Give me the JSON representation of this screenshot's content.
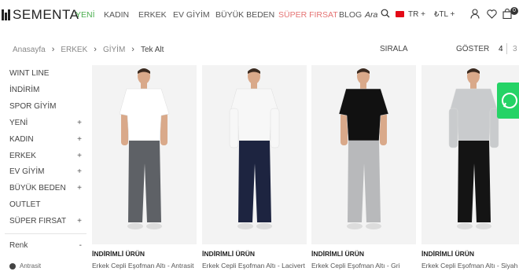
{
  "header": {
    "logo_text": "SEMENTA",
    "nav": [
      {
        "label": "YENİ",
        "style": "green"
      },
      {
        "label": "KADIN",
        "style": "normal"
      },
      {
        "label": "ERKEK",
        "style": "normal"
      },
      {
        "label": "EV GİYİM",
        "style": "normal"
      },
      {
        "label": "BÜYÜK BEDEN",
        "style": "normal"
      },
      {
        "label": "SÜPER FIRSAT",
        "style": "red"
      },
      {
        "label": "BLOG",
        "style": "normal"
      }
    ],
    "search_label": "Ara",
    "language": "TR +",
    "currency": "₺TL +",
    "cart_count": "0"
  },
  "breadcrumb": {
    "items": [
      "Anasayfa",
      "ERKEK",
      "GİYİM"
    ],
    "current": "Tek Alt"
  },
  "toolbar": {
    "sort_label": "SIRALA",
    "show_label": "GÖSTER",
    "page_active": "4",
    "page_other": "3"
  },
  "sidebar": {
    "items": [
      {
        "label": "WINT LINE",
        "plus": ""
      },
      {
        "label": "İNDİRİM",
        "plus": ""
      },
      {
        "label": "SPOR GİYİM",
        "plus": ""
      },
      {
        "label": "YENİ",
        "plus": "+"
      },
      {
        "label": "KADIN",
        "plus": "+"
      },
      {
        "label": "ERKEK",
        "plus": "+"
      },
      {
        "label": "EV GİYİM",
        "plus": "+"
      },
      {
        "label": "BÜYÜK BEDEN",
        "plus": "+"
      },
      {
        "label": "OUTLET",
        "plus": ""
      },
      {
        "label": "SÜPER FIRSAT",
        "plus": "+"
      }
    ],
    "filter_title": "Renk",
    "filter_toggle": "-",
    "filter_option": "Antrasit"
  },
  "products": [
    {
      "label": "İNDİRİMLİ ÜRÜN",
      "title": "Erkek Cepli Eşofman Altı - Antrasit",
      "shirt": "#ffffff",
      "pants": "#5e6166"
    },
    {
      "label": "İNDİRİMLİ ÜRÜN",
      "title": "Erkek Cepli Eşofman Altı - Lacivert",
      "shirt": "#f7f7f7",
      "pants": "#1d2440"
    },
    {
      "label": "İNDİRİMLİ ÜRÜN",
      "title": "Erkek Cepli Eşofman Altı - Gri",
      "shirt": "#111111",
      "pants": "#b8b9bb"
    },
    {
      "label": "İNDİRİMLİ ÜRÜN",
      "title": "Erkek Cepli Eşofman Altı - Siyah",
      "shirt": "#c9cbcd",
      "pants": "#141414"
    }
  ],
  "colors": {
    "accent_green": "#4caf50",
    "accent_red": "#e57373",
    "whatsapp": "#25d366"
  }
}
